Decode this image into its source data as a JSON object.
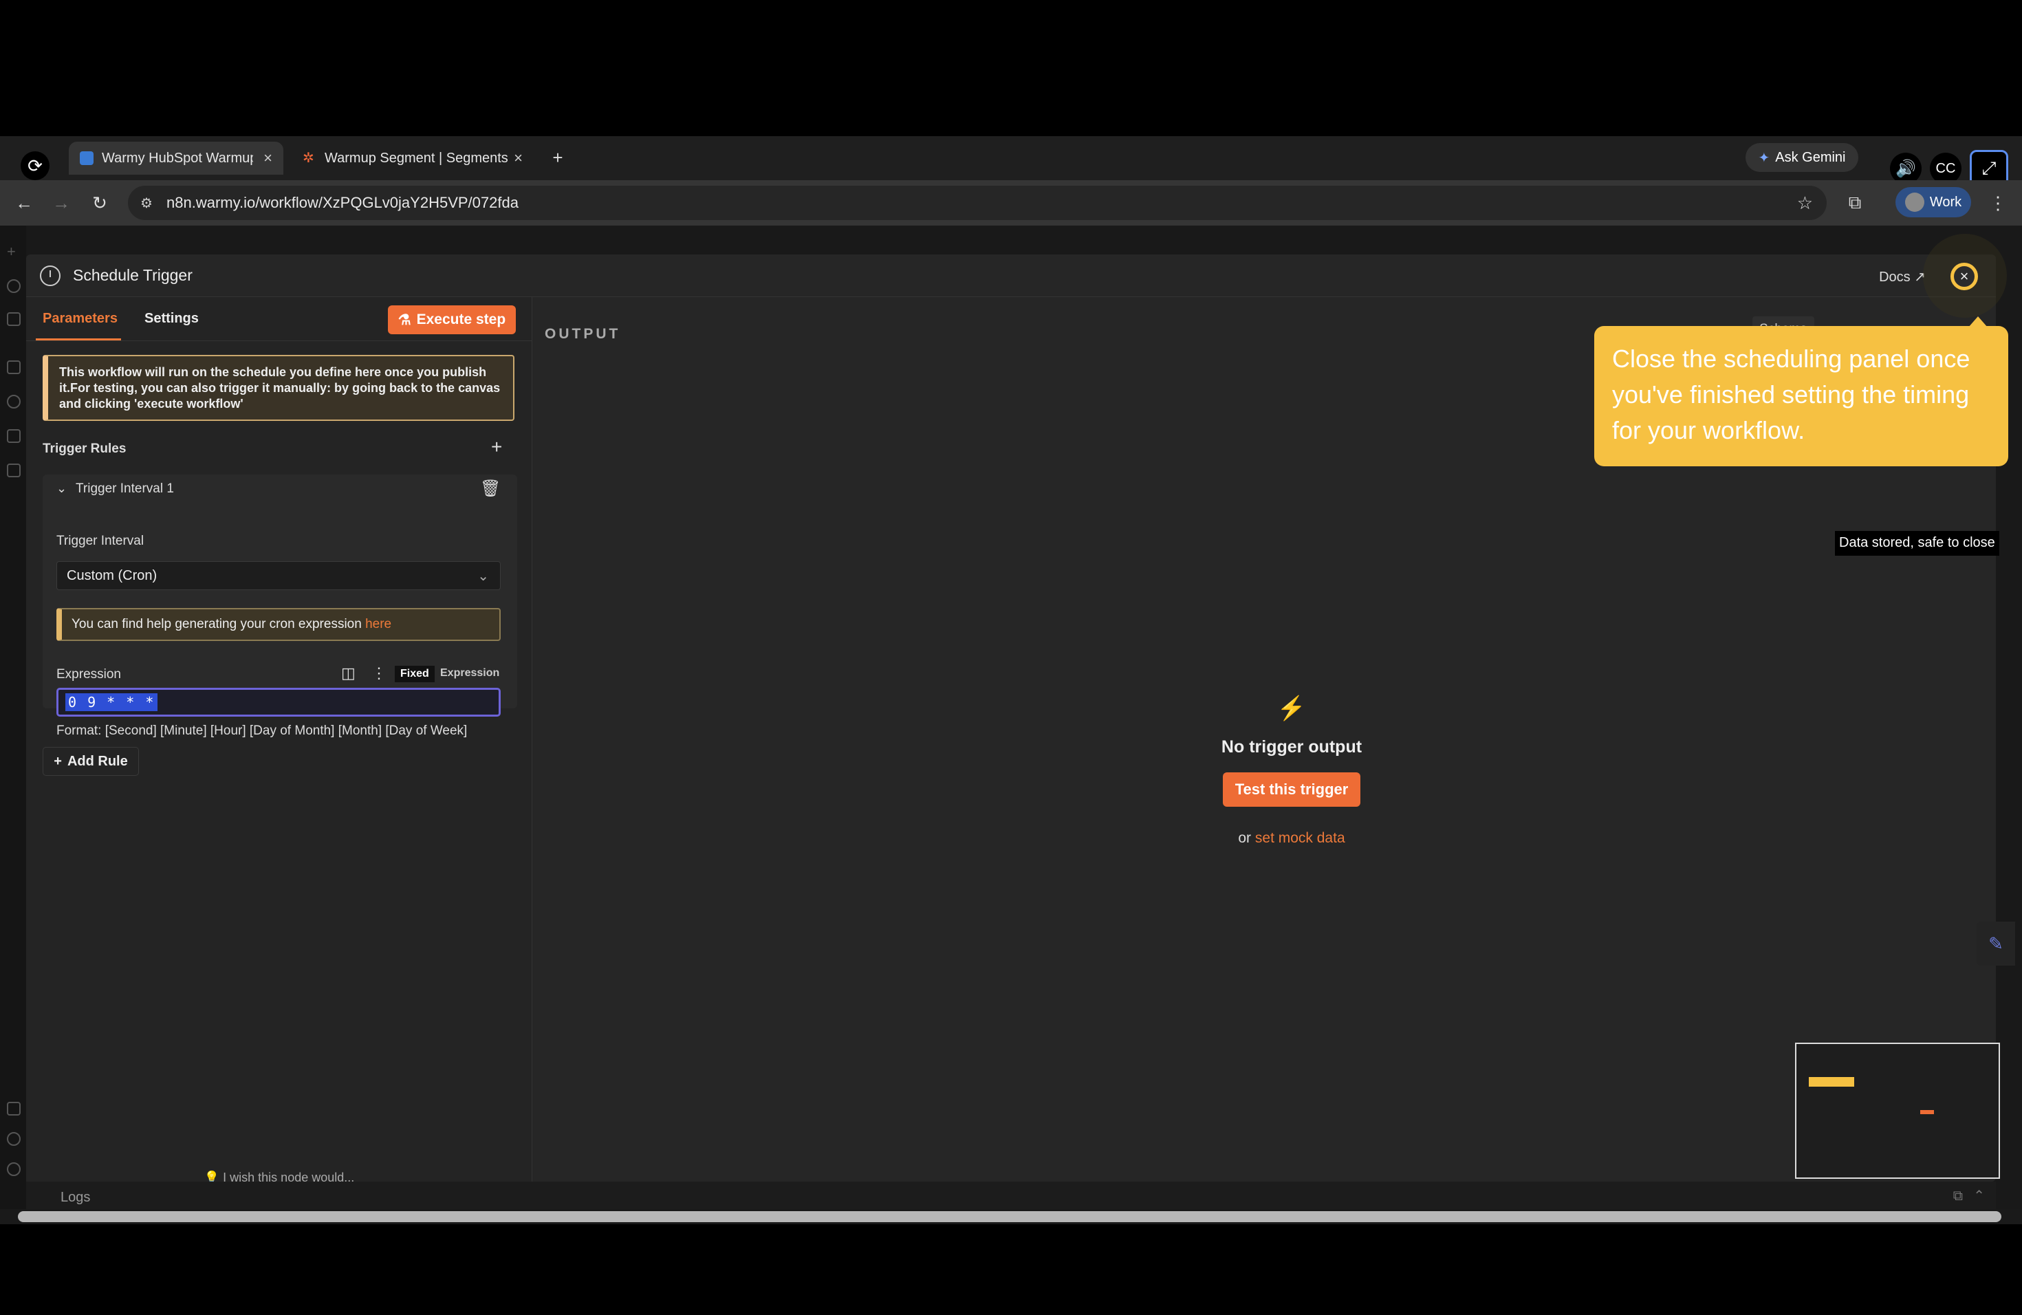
{
  "browser": {
    "tabs": [
      {
        "title": "Warmy HubSpot Warmup R",
        "active": true
      },
      {
        "title": "Warmup Segment | Segments",
        "active": false
      }
    ],
    "url": "n8n.warmy.io/workflow/XzPQGLv0jaY2H5VP/072fda",
    "gemini_label": "Ask Gemini",
    "profile_label": "Work"
  },
  "panel": {
    "title": "Schedule Trigger",
    "docs_label": "Docs",
    "tabs": {
      "parameters": "Parameters",
      "settings": "Settings"
    },
    "execute_label": "Execute step",
    "notice": "This workflow will run on the schedule you define here once you publish it.For testing, you can also trigger it manually: by going back to the canvas and clicking 'execute workflow'",
    "trigger_rules_label": "Trigger Rules",
    "interval_title": "Trigger Interval 1",
    "interval_label": "Trigger Interval",
    "interval_value": "Custom (Cron)",
    "hint_text": "You can find help generating your cron expression",
    "hint_link": "here",
    "expression_label": "Expression",
    "mode_fixed": "Fixed",
    "mode_expression": "Expression",
    "expression_value": "0 9 * * *",
    "format_text": "Format: [Second] [Minute] [Hour] [Day of Month] [Month] [Day of Week]",
    "add_rule_label": "Add Rule",
    "wish_text": "I wish this node would..."
  },
  "output": {
    "label": "OUTPUT",
    "schema_tab": "Schema",
    "empty_title": "No trigger output",
    "test_button": "Test this trigger",
    "or_text": "or",
    "mock_link": "set mock data"
  },
  "tooltip": {
    "small": "Data stored, safe to close",
    "callout": "Close the scheduling panel once you've finished setting the timing for your workflow."
  },
  "footer": {
    "logs_label": "Logs"
  },
  "colors": {
    "accent": "#ee6c35",
    "callout": "#f6c142",
    "selection": "#2e4fd6"
  }
}
